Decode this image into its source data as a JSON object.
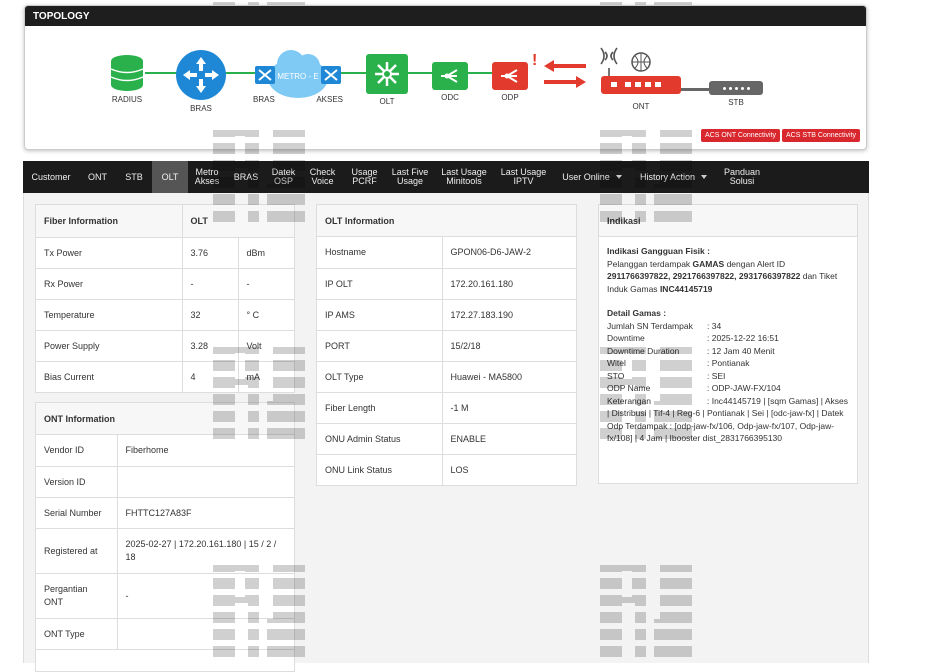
{
  "topology": {
    "title": "TOPOLOGY",
    "nodes": {
      "radius": "RADIUS",
      "bras": "BRAS",
      "metro_left": "BRAS",
      "metro": "METRO - E",
      "metro_right": "AKSES",
      "olt": "OLT",
      "odc": "ODC",
      "odp": "ODP",
      "ont": "ONT",
      "stb": "STB"
    },
    "alert_mark": "!",
    "buttons": {
      "acs_ont": "ACS ONT Connectivity",
      "acs_stb": "ACS STB Connectivity"
    },
    "colors": {
      "green": "#2ab14b",
      "blue": "#1e88d6",
      "red": "#e23b2e",
      "cloud": "#7fc9f5"
    }
  },
  "nav": {
    "customer": "Customer",
    "ont": "ONT",
    "stb": "STB",
    "olt": "OLT",
    "metro_akses_1": "Metro",
    "metro_akses_2": "Akses",
    "bras": "BRAS",
    "datek_osp_1": "Datek",
    "datek_osp_2": "OSP",
    "check_voice_1": "Check",
    "check_voice_2": "Voice",
    "usage_pcrf_1": "Usage",
    "usage_pcrf_2": "PCRF",
    "last_five_1": "Last Five",
    "last_five_2": "Usage",
    "last_minitools_1": "Last Usage",
    "last_minitools_2": "Minitools",
    "last_iptv_1": "Last Usage",
    "last_iptv_2": "IPTV",
    "user_online": "User Online",
    "history_action": "History Action",
    "panduan_1": "Panduan",
    "panduan_2": "Solusi"
  },
  "fiber": {
    "header_left": "Fiber Information",
    "header_right": "OLT",
    "rows": [
      {
        "label": "Tx Power",
        "value": "3.76",
        "unit": "dBm"
      },
      {
        "label": "Rx Power",
        "value": "-",
        "unit": "-"
      },
      {
        "label": "Temperature",
        "value": "32",
        "unit": "° C"
      },
      {
        "label": "Power Supply",
        "value": "3.28",
        "unit": "Volt"
      },
      {
        "label": "Bias Current",
        "value": "4",
        "unit": "mA"
      }
    ]
  },
  "ont_info": {
    "title": "ONT Information",
    "rows": [
      {
        "label": "Vendor ID",
        "value": "Fiberhome"
      },
      {
        "label": "Version ID",
        "value": ""
      },
      {
        "label": "Serial Number",
        "value": "FHTTC127A83F"
      },
      {
        "label": "Registered at",
        "value": "2025-02-27 | 172.20.161.180 | 15 / 2 / 18"
      },
      {
        "label": "Pergantian ONT",
        "value": "-"
      },
      {
        "label": "ONT Type",
        "value": ""
      }
    ]
  },
  "olt_info": {
    "title": "OLT Information",
    "rows": [
      {
        "label": "Hostname",
        "value": "GPON06-D6-JAW-2"
      },
      {
        "label": "IP OLT",
        "value": "172.20.161.180"
      },
      {
        "label": "IP AMS",
        "value": "172.27.183.190"
      },
      {
        "label": "PORT",
        "value": "15/2/18"
      },
      {
        "label": "OLT Type",
        "value": "Huawei - MA5800"
      },
      {
        "label": "Fiber Length",
        "value": "-1 M"
      },
      {
        "label": "ONU Admin Status",
        "value": "ENABLE"
      },
      {
        "label": "ONU Link Status",
        "value": "LOS"
      }
    ]
  },
  "indikasi": {
    "title": "Indikasi",
    "gangguan_title": "Indikasi Gangguan Fisik :",
    "gangguan_text_1": "Pelanggan terdampak",
    "gangguan_gamas": "GAMAS",
    "gangguan_text_2": "dengan Alert ID",
    "alert_ids": "2911766397822, 2921766397822, 2931766397822",
    "gangguan_text_3": "dan Tiket Induk Gamas",
    "tiket": "INC44145719",
    "detail_title": "Detail Gamas :",
    "details": [
      {
        "k": "Jumlah SN Terdampak",
        "v": ": 34"
      },
      {
        "k": "Downtime",
        "v": ": 2025-12-22 16:51"
      },
      {
        "k": "Downtime Duration",
        "v": ": 12 Jam 40 Menit"
      },
      {
        "k": "Witel",
        "v": ": Pontianak"
      },
      {
        "k": "STO",
        "v": ": SEI"
      },
      {
        "k": "ODP Name",
        "v": ": ODP-JAW-FX/104"
      }
    ],
    "keterangan_label": "Keterangan",
    "keterangan_text": ": Inc44145719 | [sqm Gamas] | Akses | Distribusi | Tif-4 | Reg-6 | Pontianak | Sei | [odc-jaw-fx] | Datek Odp Terdampak : [odp-jaw-fx/106, Odp-jaw-fx/107, Odp-jaw-fx/108] | 4 Jam | Ibooster dist_2831766395130"
  }
}
